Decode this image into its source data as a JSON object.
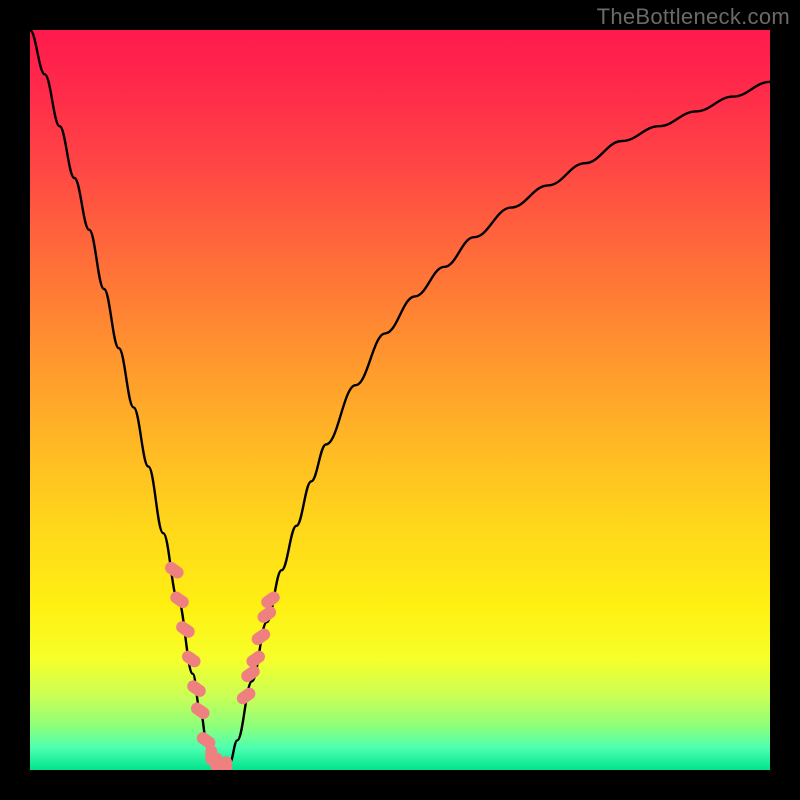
{
  "watermark": "TheBottleneck.com",
  "colors": {
    "background": "#000000",
    "curve": "#000000",
    "marker": "#ef8080",
    "gradient_top": "#ff1a4d",
    "gradient_bottom": "#00e38c"
  },
  "chart_data": {
    "type": "line",
    "title": "",
    "xlabel": "",
    "ylabel": "",
    "xlim": [
      0,
      100
    ],
    "ylim": [
      0,
      100
    ],
    "notes": "Black curve on vertical red→green gradient. Curve dives from top-left to a minimum near x≈24, then rises smoothly to the right approaching the top. Pink dots cluster around the minimum and slightly to its right. Y-axis is inverted visually (value 100 at top corresponds to large mismatch / red).",
    "series": [
      {
        "name": "curve",
        "x": [
          0,
          2,
          4,
          6,
          8,
          10,
          12,
          14,
          16,
          18,
          20,
          22,
          23,
          24,
          25,
          26,
          27,
          28,
          30,
          32,
          34,
          36,
          38,
          40,
          44,
          48,
          52,
          56,
          60,
          65,
          70,
          75,
          80,
          85,
          90,
          95,
          100
        ],
        "y": [
          100,
          94,
          87,
          80,
          73,
          65,
          57,
          49,
          41,
          32,
          23,
          13,
          8,
          3,
          1,
          0,
          1,
          4,
          12,
          20,
          27,
          33,
          39,
          44,
          52,
          59,
          64,
          68,
          72,
          76,
          79,
          82,
          85,
          87,
          89,
          91,
          93
        ]
      }
    ],
    "markers": {
      "name": "dots",
      "x": [
        19.5,
        20.2,
        21.0,
        21.8,
        22.5,
        23.0,
        23.8,
        24.5,
        25.2,
        25.8,
        26.5,
        29.2,
        29.8,
        30.5,
        31.2,
        32.0,
        32.5
      ],
      "y": [
        27,
        23,
        19,
        15,
        11,
        8,
        4,
        2,
        1,
        0,
        0.5,
        10,
        13,
        15,
        18,
        21,
        23
      ]
    }
  }
}
